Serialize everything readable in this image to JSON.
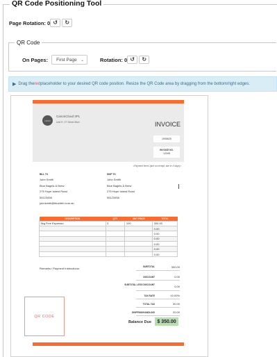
{
  "tool_title": "QR Code Positioning Tool",
  "page_rotation": {
    "label": "Page Rotation:",
    "value": "0",
    "rotate_left_icon": "rotate-ccw",
    "rotate_right_icon": "rotate-cw"
  },
  "qr_code_section": {
    "legend": "QR Code",
    "on_pages_label": "On Pages:",
    "on_pages_value": "First Page",
    "rotation_label": "Rotation:",
    "rotation_value": "0"
  },
  "info": {
    "pre": "Drag the ",
    "red_word": "red",
    "post": " placeholder to your desired QR code position. Resize the QR Code area by dragging from the bottom/right edges."
  },
  "invoice": {
    "company": "CanonCloud 3PL",
    "address": "Unit E, 27 Street Blvd",
    "logo_text": "LOGO",
    "title": "INVOICE",
    "date": "19/08/20",
    "no_label": "INVOICE NO.",
    "no_value": "12345",
    "payment_terms": "<Payment terms (due on receipt, due in X days)>",
    "bill_to": {
      "label": "BILL TO",
      "name": "John Smith",
      "company": "Blue Bagels & Brew",
      "street": "275 Hope Island Road",
      "phone": "55123456",
      "email": "johnsmith@bluebbh.com.au"
    },
    "ship_to": {
      "label": "SHIP TO",
      "name": "John Smith",
      "company": "Blue Bagels & Brew",
      "street": "275 Hope Island Road",
      "phone": "55123456"
    },
    "table_headers": [
      "DESCRIPTION",
      "QTY",
      "UNIT PRICE",
      "TOTAL"
    ],
    "rows": [
      [
        "5kg Fine Espresso",
        "3",
        "100",
        "300.00"
      ],
      [
        "",
        "",
        "",
        "0.00"
      ],
      [
        "",
        "",
        "",
        "0.00"
      ],
      [
        "",
        "",
        "",
        "0.00"
      ],
      [
        "",
        "",
        "",
        "0.00"
      ],
      [
        "",
        "",
        "",
        "0.00"
      ],
      [
        "",
        "",
        "",
        "0.00"
      ]
    ],
    "remarks_label": "Remarks / Payment Instructions:",
    "qr_placeholder": "QR CODE",
    "subtotal_label": "SUBTOTAL",
    "subtotal": "300.00",
    "discount_label": "DISCOUNT",
    "discount": "0.00",
    "subtotal_less_label": "SUBTOTAL LESS DISCOUNT",
    "subtotal_less": "0.00",
    "tax_rate_label": "TAX RATE",
    "tax_rate": "10.00%",
    "total_tax_label": "TOTAL TAX",
    "total_tax": "30.00",
    "shipping_label": "SHIPPING/HANDLING",
    "shipping": "20.00",
    "balance_label": "Balance Due",
    "balance": "$ 350.00"
  },
  "colors": {
    "accent": "#ff6a2c",
    "balance_bg": "#b7ddb0",
    "info_bg": "#d9edf7",
    "qr_border": "#e89a8a"
  }
}
